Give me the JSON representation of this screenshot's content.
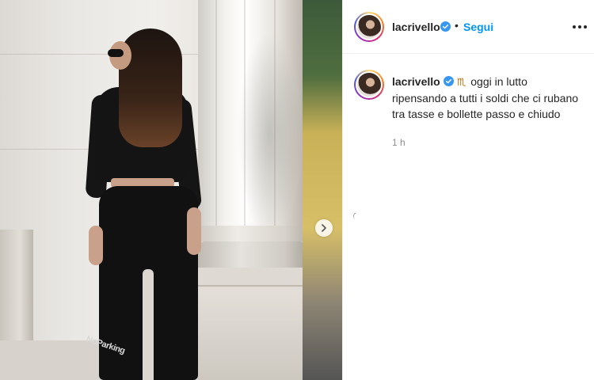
{
  "post": {
    "photo": {
      "alt_icons": {
        "next": "chevron-right-icon"
      },
      "pants_print": "NoParking"
    },
    "header": {
      "username": "lacrivello",
      "separator": "•",
      "follow_label": "Segui",
      "more_icon": "more-horizontal-icon",
      "verified_icon": "verified-badge-icon"
    },
    "caption": {
      "username": "lacrivello",
      "emoji": "♏",
      "text": "oggi in lutto ripensando a tutti i soldi che ci rubano tra tasse e bollette passo e chiudo",
      "time": "1 h"
    }
  },
  "colors": {
    "link_blue": "#0095f6",
    "text": "#262626",
    "muted": "#8e8e8e",
    "verified": "#3897f0"
  }
}
